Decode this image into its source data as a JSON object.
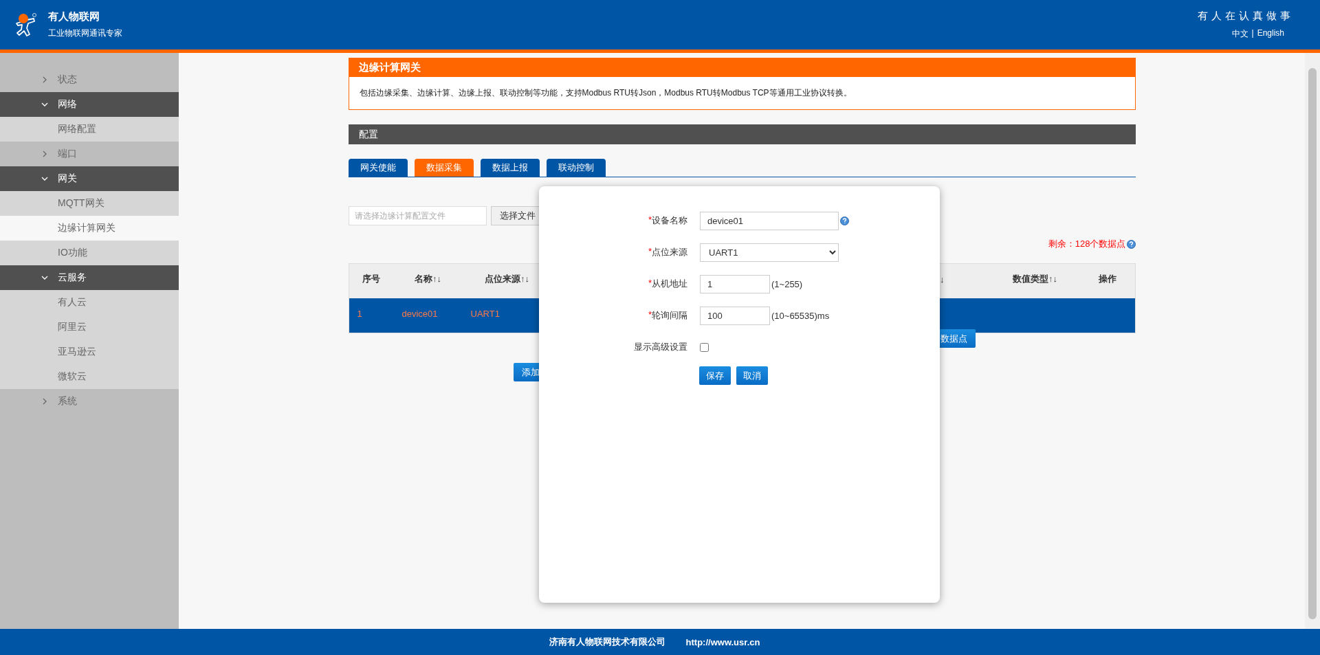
{
  "header": {
    "brand": "有人物联网",
    "tagline": "工业物联网通讯专家",
    "slogan": "有人在认真做事",
    "languages": [
      "中文",
      "English"
    ],
    "separator": "|"
  },
  "sidebar": {
    "items": [
      {
        "label": "状态",
        "expanded": false
      },
      {
        "label": "网络",
        "expanded": true,
        "children": [
          {
            "label": "网络配置",
            "selected": false
          }
        ]
      },
      {
        "label": "端口",
        "expanded": false
      },
      {
        "label": "网关",
        "expanded": true,
        "children": [
          {
            "label": "MQTT网关",
            "selected": false
          },
          {
            "label": "边缘计算网关",
            "selected": true
          },
          {
            "label": "IO功能",
            "selected": false
          }
        ]
      },
      {
        "label": "云服务",
        "expanded": true,
        "children": [
          {
            "label": "有人云",
            "selected": false
          },
          {
            "label": "阿里云",
            "selected": false
          },
          {
            "label": "亚马逊云",
            "selected": false
          },
          {
            "label": "微软云",
            "selected": false
          }
        ]
      },
      {
        "label": "系统",
        "expanded": false
      }
    ]
  },
  "intro": {
    "title": "边缘计算网关",
    "text": "包括边缘采集、边缘计算、边缘上报、联动控制等功能，支持Modbus RTU转Json，Modbus RTU转Modbus TCP等通用工业协议转换。"
  },
  "config": {
    "title": "配置",
    "tabs": [
      {
        "label": "网关使能",
        "selected": false
      },
      {
        "label": "数据采集",
        "selected": true
      },
      {
        "label": "数据上报",
        "selected": false
      },
      {
        "label": "联动控制",
        "selected": false
      }
    ]
  },
  "import": {
    "placeholder": "请选择边缘计算配置文件",
    "button": "选择文件"
  },
  "remaining": "剩余：128个数据点",
  "table": {
    "columns": [
      "序号",
      "名称↑↓",
      "点位来源↑↓",
      "↓",
      "数值类型↑↓",
      "操作"
    ],
    "rows": [
      {
        "selected": true,
        "cells": [
          "1",
          "device01",
          "UART1"
        ]
      }
    ]
  },
  "add_point_button": "数据点",
  "add_button": "添加",
  "dialog": {
    "fields": [
      {
        "kind": "text",
        "mark": "*",
        "label": "设备名称",
        "value": "device01",
        "help": true
      },
      {
        "kind": "select",
        "mark": "*",
        "label": "点位来源",
        "value": "UART1"
      },
      {
        "kind": "short",
        "mark": "*",
        "label": "从机地址",
        "value": "1",
        "hint": "(1~255)"
      },
      {
        "kind": "short",
        "mark": "*",
        "label": "轮询间隔",
        "value": "100",
        "hint": "(10~65535)ms"
      },
      {
        "kind": "checkbox",
        "label": "显示高级设置",
        "checked": false
      }
    ],
    "buttons": [
      "保存",
      "取消"
    ]
  },
  "footer": {
    "company": "济南有人物联网技术有限公司",
    "url": "http://www.usr.cn"
  }
}
